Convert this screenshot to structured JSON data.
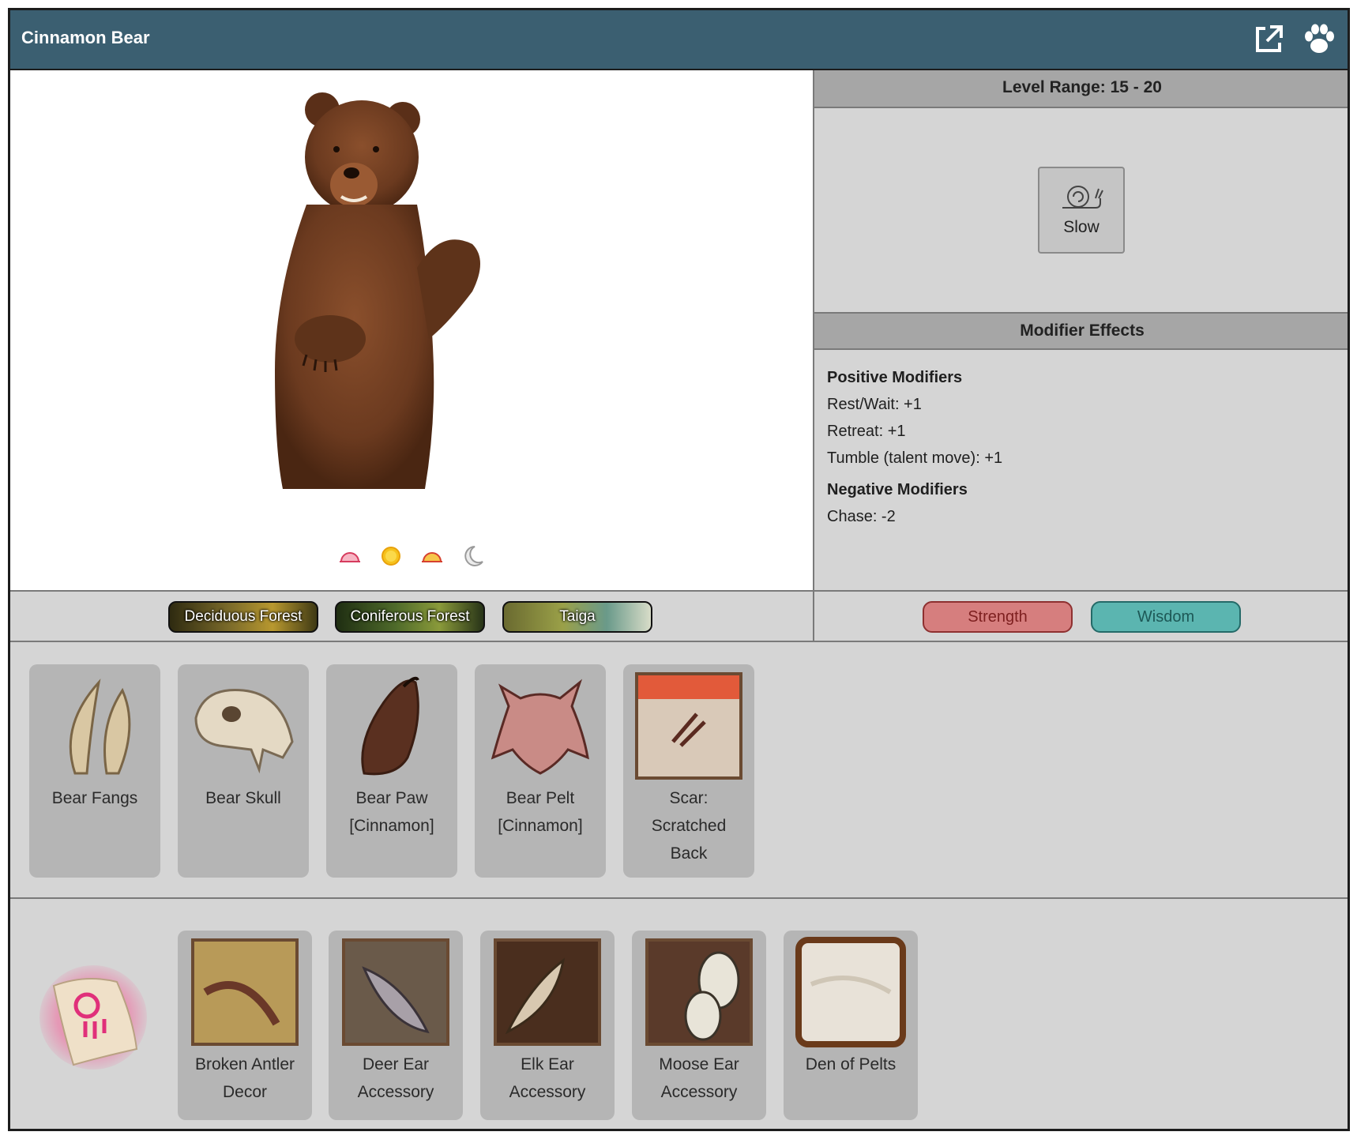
{
  "header": {
    "title": "Cinnamon Bear",
    "icons": [
      "external-link-icon",
      "paw-icon"
    ]
  },
  "times_of_day": [
    "dawn-icon",
    "day-icon",
    "dusk-icon",
    "night-icon"
  ],
  "level": {
    "label": "Level Range: 15 - 20"
  },
  "speed": {
    "label": "Slow",
    "icon": "snail-icon"
  },
  "modifiers": {
    "heading": "Modifier Effects",
    "positive_heading": "Positive Modifiers",
    "positive": [
      "Rest/Wait: +1",
      "Retreat: +1",
      "Tumble (talent move): +1"
    ],
    "negative_heading": "Negative Modifiers",
    "negative": [
      "Chase: -2"
    ]
  },
  "biomes": [
    "Deciduous Forest",
    "Coniferous Forest",
    "Taiga"
  ],
  "stats": [
    {
      "label": "Strength",
      "color": "#d67e7e"
    },
    {
      "label": "Wisdom",
      "color": "#5bb5b0"
    }
  ],
  "drops": [
    {
      "line1": "Bear Fangs",
      "line2": "",
      "line3": ""
    },
    {
      "line1": "Bear Skull",
      "line2": "",
      "line3": ""
    },
    {
      "line1": "Bear Paw",
      "line2": "[Cinnamon]",
      "line3": ""
    },
    {
      "line1": "Bear Pelt",
      "line2": "[Cinnamon]",
      "line3": ""
    },
    {
      "line1": "Scar:",
      "line2": "Scratched",
      "line3": "Back"
    }
  ],
  "rewards": [
    {
      "line1": "Broken Antler",
      "line2": "Decor"
    },
    {
      "line1": "Deer Ear",
      "line2": "Accessory"
    },
    {
      "line1": "Elk Ear",
      "line2": "Accessory"
    },
    {
      "line1": "Moose Ear",
      "line2": "Accessory"
    },
    {
      "line1": "Den of Pelts",
      "line2": ""
    }
  ]
}
